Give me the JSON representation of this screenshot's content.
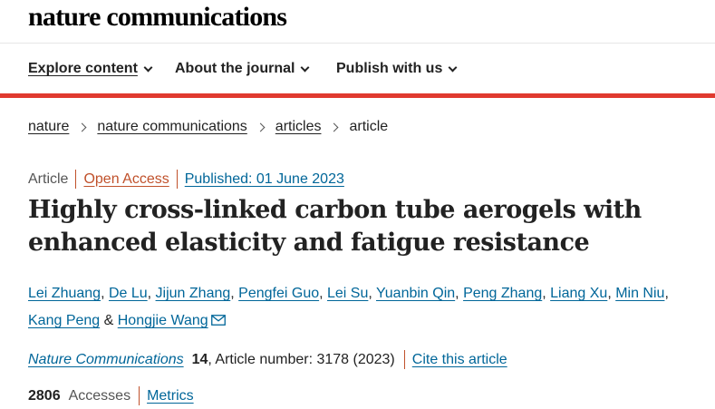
{
  "site": {
    "logo_text": "nature communications"
  },
  "nav": {
    "items": [
      {
        "label": "Explore content"
      },
      {
        "label": "About the journal"
      },
      {
        "label": "Publish with us"
      }
    ]
  },
  "breadcrumb": {
    "items": [
      "nature",
      "nature communications",
      "articles"
    ],
    "current": "article"
  },
  "article": {
    "type": "Article",
    "access": "Open Access",
    "published": "Published: 01 June 2023",
    "title": "Highly cross-linked carbon tube aerogels with enhanced elasticity and fatigue resistance",
    "authors": [
      "Lei Zhuang",
      "De Lu",
      "Jijun Zhang",
      "Pengfei Guo",
      "Lei Su",
      "Yuanbin Qin",
      "Peng Zhang",
      "Liang Xu",
      "Min Niu",
      "Kang Peng",
      "Hongjie Wang"
    ],
    "journal": "Nature Communications",
    "volume": "14",
    "article_number": ", Article number: 3178 (2023)",
    "cite_label": "Cite this article",
    "accesses_count": "2806",
    "accesses_label": "Accesses",
    "metrics_label": "Metrics"
  },
  "icons": {
    "email": "envelope-icon",
    "nav_dropdown": "chevron-down-icon",
    "breadcrumb_sep": "chevron-right-icon"
  },
  "colors": {
    "accent_bar": "#e03a2f",
    "link": "#006699",
    "open_access": "#c0512b",
    "divider": "#c0512b",
    "text": "#222222"
  }
}
